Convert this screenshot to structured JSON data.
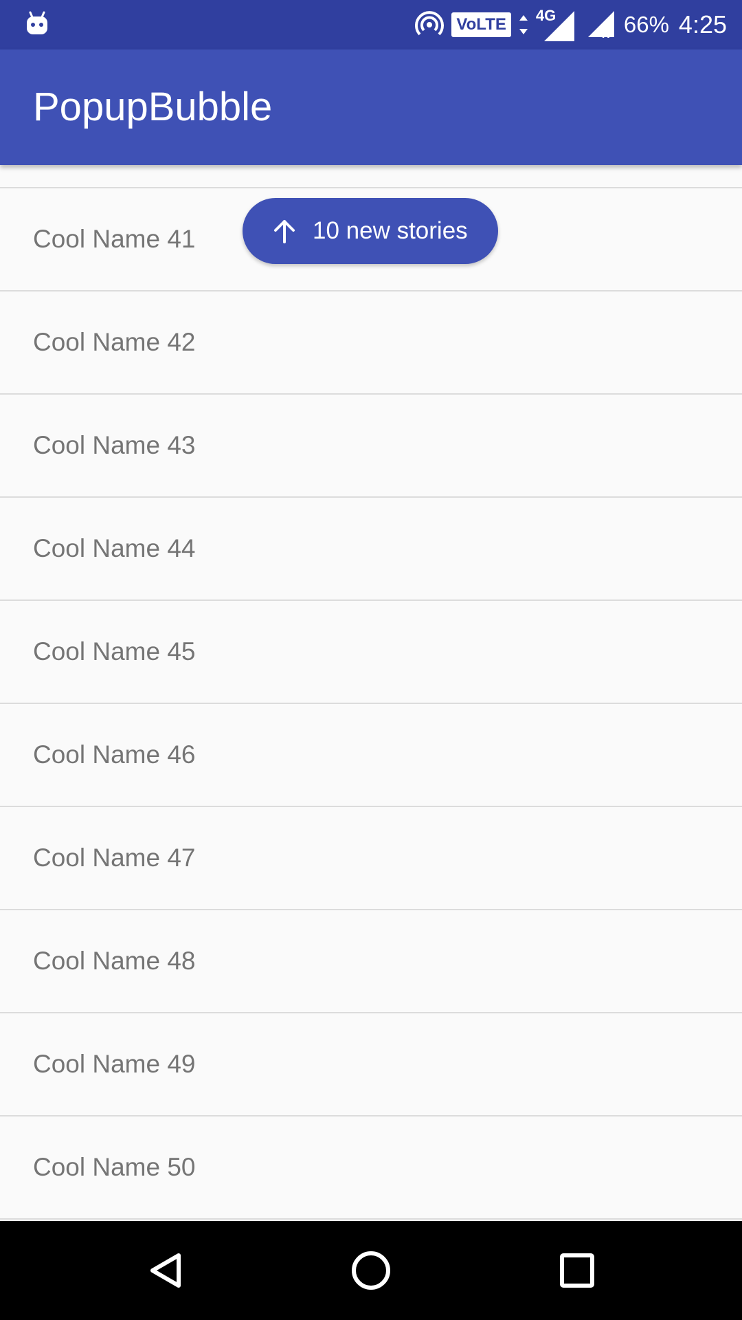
{
  "status_bar": {
    "battery": "66%",
    "time": "4:25",
    "volte_label": "VoLTE",
    "network_label": "4G",
    "roaming_label": "R",
    "icons": [
      "app-notification-icon",
      "hotspot-icon",
      "volte-icon",
      "data-arrows-icon",
      "signal-icon",
      "roaming-signal-icon"
    ]
  },
  "app_bar": {
    "title": "PopupBubble"
  },
  "list": {
    "items": [
      "Cool Name 41",
      "Cool Name 42",
      "Cool Name 43",
      "Cool Name 44",
      "Cool Name 45",
      "Cool Name 46",
      "Cool Name 47",
      "Cool Name 48",
      "Cool Name 49",
      "Cool Name 50"
    ]
  },
  "bubble": {
    "label": "10 new stories",
    "icon": "arrow-up-icon"
  },
  "nav_bar": {
    "icons": [
      "back-icon",
      "home-icon",
      "recents-icon"
    ]
  },
  "colors": {
    "status_bar": "#303f9f",
    "app_bar": "#3f51b5",
    "bubble": "#3f51b5",
    "list_background": "#fafafa",
    "list_text": "#757575",
    "divider": "#dcdcdc",
    "nav_bar": "#000000"
  }
}
